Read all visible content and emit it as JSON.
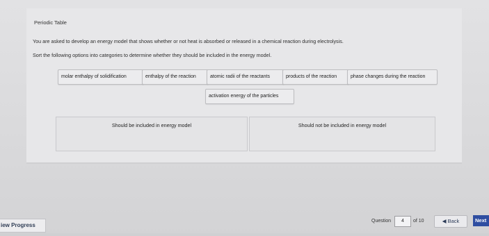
{
  "page": {
    "section_title": "Periodic Table",
    "instructions_line1": "You are asked to develop an energy model that shows whether or not heat is absorbed or released in a chemical reaction during electrolysis.",
    "instructions_line2": "Sort the following options into categories to determine whether they should be included in the energy model."
  },
  "options": [
    "molar enthalpy of solidification",
    "enthalpy of the reaction",
    "atomic radii of the reactants",
    "products of the reaction",
    "phase changes during the reaction",
    "activation energy of the particles"
  ],
  "categories": {
    "include": "Should be included in energy model",
    "exclude": "Should not be included in energy model"
  },
  "footer": {
    "review_label": "iew Progress",
    "question_label": "Question",
    "question_value": "4",
    "of_label": "of 10",
    "back_label": "Back",
    "next_label": "Next"
  },
  "icons": {
    "back": "chevron-left-icon"
  },
  "colors": {
    "next_button_bg": "#2f4ea1",
    "text_dark": "#2b2b2b",
    "panel_bg": "#e7e7e9"
  }
}
